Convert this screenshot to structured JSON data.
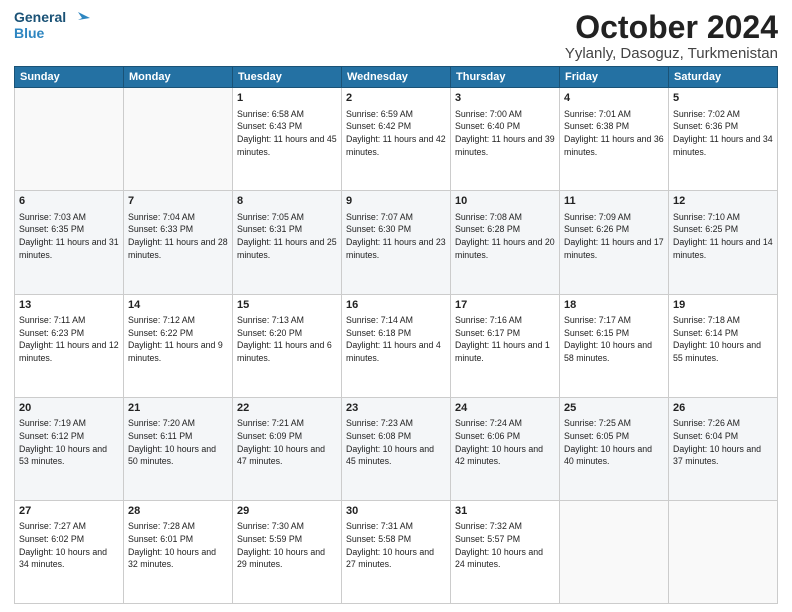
{
  "header": {
    "logo_line1": "General",
    "logo_line2": "Blue",
    "month_title": "October 2024",
    "location": "Yylanly, Dasoguz, Turkmenistan"
  },
  "days_of_week": [
    "Sunday",
    "Monday",
    "Tuesday",
    "Wednesday",
    "Thursday",
    "Friday",
    "Saturday"
  ],
  "weeks": [
    [
      {
        "day": "",
        "info": ""
      },
      {
        "day": "",
        "info": ""
      },
      {
        "day": "1",
        "info": "Sunrise: 6:58 AM\nSunset: 6:43 PM\nDaylight: 11 hours and 45 minutes."
      },
      {
        "day": "2",
        "info": "Sunrise: 6:59 AM\nSunset: 6:42 PM\nDaylight: 11 hours and 42 minutes."
      },
      {
        "day": "3",
        "info": "Sunrise: 7:00 AM\nSunset: 6:40 PM\nDaylight: 11 hours and 39 minutes."
      },
      {
        "day": "4",
        "info": "Sunrise: 7:01 AM\nSunset: 6:38 PM\nDaylight: 11 hours and 36 minutes."
      },
      {
        "day": "5",
        "info": "Sunrise: 7:02 AM\nSunset: 6:36 PM\nDaylight: 11 hours and 34 minutes."
      }
    ],
    [
      {
        "day": "6",
        "info": "Sunrise: 7:03 AM\nSunset: 6:35 PM\nDaylight: 11 hours and 31 minutes."
      },
      {
        "day": "7",
        "info": "Sunrise: 7:04 AM\nSunset: 6:33 PM\nDaylight: 11 hours and 28 minutes."
      },
      {
        "day": "8",
        "info": "Sunrise: 7:05 AM\nSunset: 6:31 PM\nDaylight: 11 hours and 25 minutes."
      },
      {
        "day": "9",
        "info": "Sunrise: 7:07 AM\nSunset: 6:30 PM\nDaylight: 11 hours and 23 minutes."
      },
      {
        "day": "10",
        "info": "Sunrise: 7:08 AM\nSunset: 6:28 PM\nDaylight: 11 hours and 20 minutes."
      },
      {
        "day": "11",
        "info": "Sunrise: 7:09 AM\nSunset: 6:26 PM\nDaylight: 11 hours and 17 minutes."
      },
      {
        "day": "12",
        "info": "Sunrise: 7:10 AM\nSunset: 6:25 PM\nDaylight: 11 hours and 14 minutes."
      }
    ],
    [
      {
        "day": "13",
        "info": "Sunrise: 7:11 AM\nSunset: 6:23 PM\nDaylight: 11 hours and 12 minutes."
      },
      {
        "day": "14",
        "info": "Sunrise: 7:12 AM\nSunset: 6:22 PM\nDaylight: 11 hours and 9 minutes."
      },
      {
        "day": "15",
        "info": "Sunrise: 7:13 AM\nSunset: 6:20 PM\nDaylight: 11 hours and 6 minutes."
      },
      {
        "day": "16",
        "info": "Sunrise: 7:14 AM\nSunset: 6:18 PM\nDaylight: 11 hours and 4 minutes."
      },
      {
        "day": "17",
        "info": "Sunrise: 7:16 AM\nSunset: 6:17 PM\nDaylight: 11 hours and 1 minute."
      },
      {
        "day": "18",
        "info": "Sunrise: 7:17 AM\nSunset: 6:15 PM\nDaylight: 10 hours and 58 minutes."
      },
      {
        "day": "19",
        "info": "Sunrise: 7:18 AM\nSunset: 6:14 PM\nDaylight: 10 hours and 55 minutes."
      }
    ],
    [
      {
        "day": "20",
        "info": "Sunrise: 7:19 AM\nSunset: 6:12 PM\nDaylight: 10 hours and 53 minutes."
      },
      {
        "day": "21",
        "info": "Sunrise: 7:20 AM\nSunset: 6:11 PM\nDaylight: 10 hours and 50 minutes."
      },
      {
        "day": "22",
        "info": "Sunrise: 7:21 AM\nSunset: 6:09 PM\nDaylight: 10 hours and 47 minutes."
      },
      {
        "day": "23",
        "info": "Sunrise: 7:23 AM\nSunset: 6:08 PM\nDaylight: 10 hours and 45 minutes."
      },
      {
        "day": "24",
        "info": "Sunrise: 7:24 AM\nSunset: 6:06 PM\nDaylight: 10 hours and 42 minutes."
      },
      {
        "day": "25",
        "info": "Sunrise: 7:25 AM\nSunset: 6:05 PM\nDaylight: 10 hours and 40 minutes."
      },
      {
        "day": "26",
        "info": "Sunrise: 7:26 AM\nSunset: 6:04 PM\nDaylight: 10 hours and 37 minutes."
      }
    ],
    [
      {
        "day": "27",
        "info": "Sunrise: 7:27 AM\nSunset: 6:02 PM\nDaylight: 10 hours and 34 minutes."
      },
      {
        "day": "28",
        "info": "Sunrise: 7:28 AM\nSunset: 6:01 PM\nDaylight: 10 hours and 32 minutes."
      },
      {
        "day": "29",
        "info": "Sunrise: 7:30 AM\nSunset: 5:59 PM\nDaylight: 10 hours and 29 minutes."
      },
      {
        "day": "30",
        "info": "Sunrise: 7:31 AM\nSunset: 5:58 PM\nDaylight: 10 hours and 27 minutes."
      },
      {
        "day": "31",
        "info": "Sunrise: 7:32 AM\nSunset: 5:57 PM\nDaylight: 10 hours and 24 minutes."
      },
      {
        "day": "",
        "info": ""
      },
      {
        "day": "",
        "info": ""
      }
    ]
  ]
}
